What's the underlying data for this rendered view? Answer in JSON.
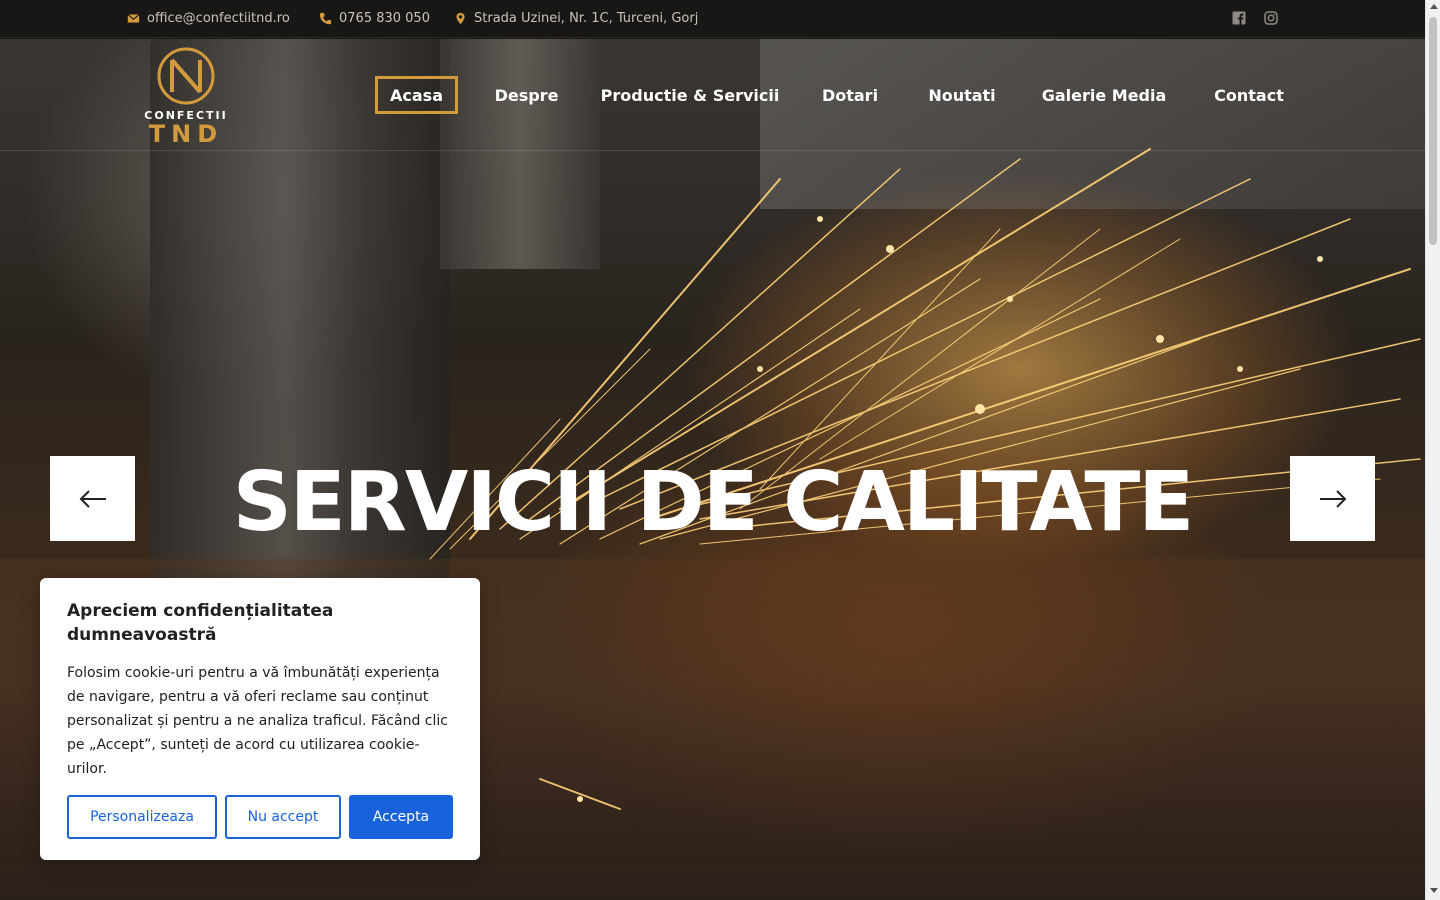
{
  "topbar": {
    "email": "office@confectiitnd.ro",
    "phone": "0765 830 050",
    "address": "Strada Uzinei, Nr. 1C, Turceni, Gorj",
    "accent_color": "#d29a3c",
    "social": [
      "facebook-icon",
      "instagram-icon"
    ]
  },
  "logo": {
    "line1": "CONFECTII",
    "line2": "TND"
  },
  "nav": {
    "items": [
      "Acasa",
      "Despre",
      "Productie & Servicii",
      "Dotari",
      "Noutati",
      "Galerie Media",
      "Contact"
    ],
    "active": "Acasa"
  },
  "hero": {
    "title": "SERVICII DE CALITATE",
    "prev_icon": "arrow-left-icon",
    "next_icon": "arrow-right-icon"
  },
  "cookie": {
    "title": "Apreciem confidențialitatea dumneavoastră",
    "text": "Folosim cookie-uri pentru a vă îmbunătăți experiența de navigare, pentru a vă oferi reclame sau conținut personalizat și pentru a ne analiza traficul. Făcând clic pe „Accept”, sunteți de acord cu utilizarea cookie-urilor.",
    "btn_customize": "Personalizeaza",
    "btn_reject": "Nu accept",
    "btn_accept": "Accepta",
    "button_color": "#1863dc"
  }
}
